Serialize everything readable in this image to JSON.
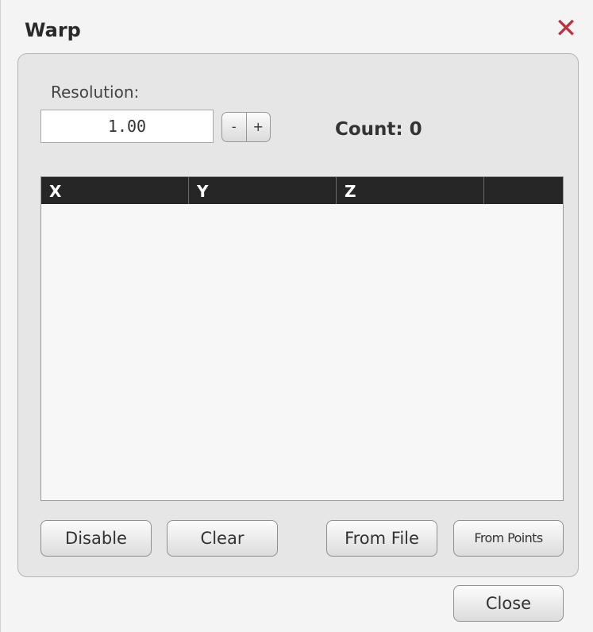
{
  "dialog": {
    "title": "Warp",
    "close_icon": "close-icon",
    "close_color": "#c0303a"
  },
  "resolution": {
    "label": "Resolution:",
    "value": "1.00",
    "decrement_label": "-",
    "increment_label": "+"
  },
  "count": {
    "text": "Count: 0"
  },
  "table": {
    "columns": [
      "X",
      "Y",
      "Z",
      ""
    ],
    "rows": []
  },
  "buttons": {
    "disable": "Disable",
    "clear": "Clear",
    "from_file": "From File",
    "from_points": "From Points",
    "close": "Close"
  }
}
